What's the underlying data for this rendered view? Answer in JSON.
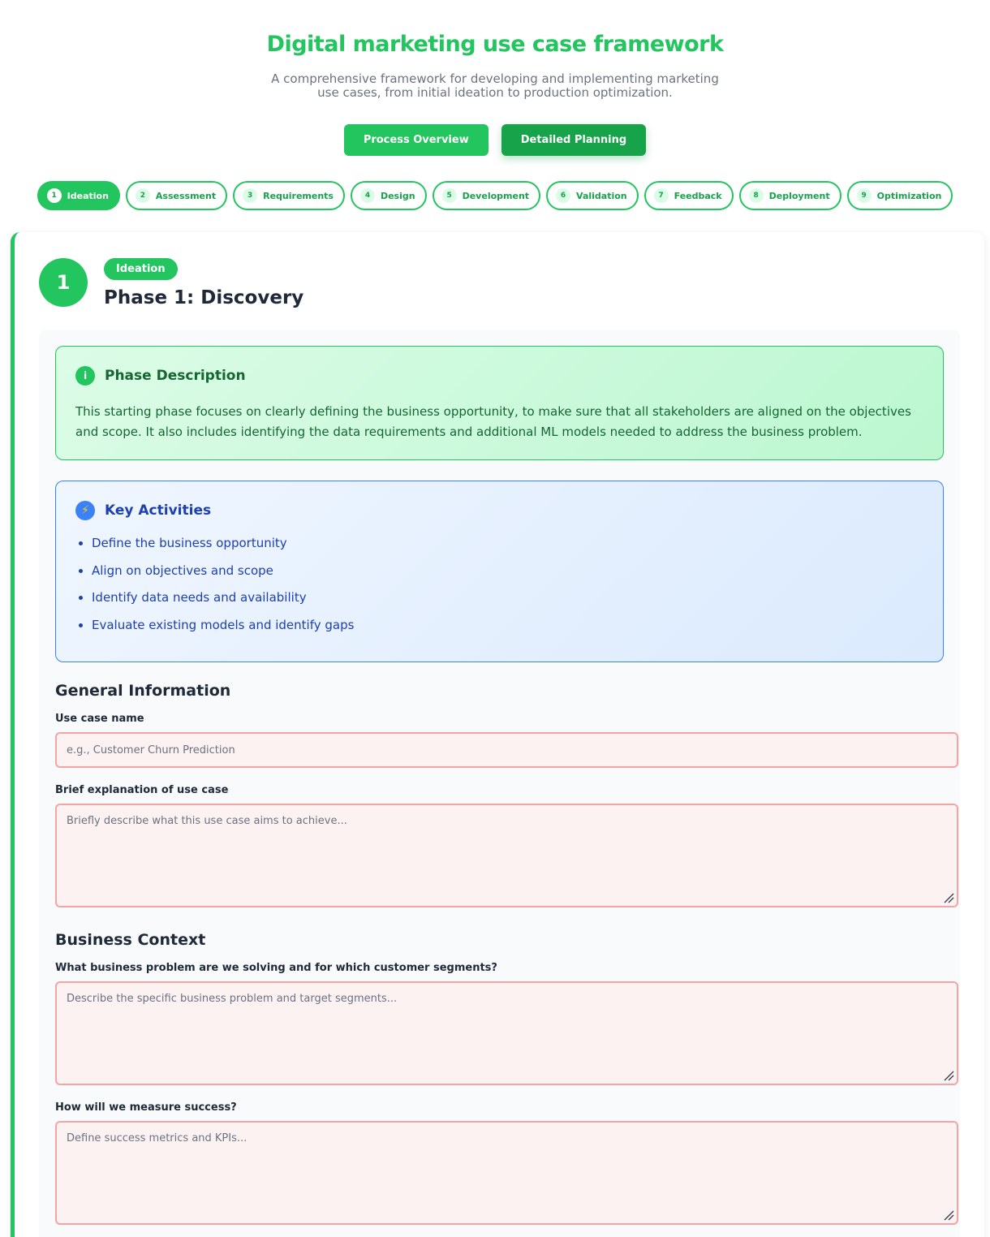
{
  "header": {
    "title": "Digital marketing use case framework",
    "subtitle": "A comprehensive framework for developing and implementing marketing use cases, from initial ideation to production optimization."
  },
  "view_buttons": {
    "process_overview": "Process Overview",
    "detailed_planning": "Detailed Planning",
    "active": "detailed_planning"
  },
  "phase_tabs": [
    {
      "num": "1",
      "label": "Ideation",
      "active": true
    },
    {
      "num": "2",
      "label": "Assessment"
    },
    {
      "num": "3",
      "label": "Requirements"
    },
    {
      "num": "4",
      "label": "Design"
    },
    {
      "num": "5",
      "label": "Development"
    },
    {
      "num": "6",
      "label": "Validation"
    },
    {
      "num": "7",
      "label": "Feedback"
    },
    {
      "num": "8",
      "label": "Deployment"
    },
    {
      "num": "9",
      "label": "Optimization"
    }
  ],
  "phase": {
    "number": "1",
    "badge": "Ideation",
    "title": "Phase 1: Discovery",
    "description": {
      "icon": "info-icon",
      "title": "Phase Description",
      "text": "This starting phase focuses on clearly defining the business opportunity, to make sure that all stakeholders are aligned on the objectives and scope. It also includes identifying the data requirements and additional ML models needed to address the business problem."
    },
    "activities": {
      "icon": "lightning-icon",
      "title": "Key Activities",
      "items": [
        "Define the business opportunity",
        "Align on objectives and scope",
        "Identify data needs and availability",
        "Evaluate existing models and identify gaps"
      ]
    }
  },
  "general": {
    "title": "General Information",
    "use_case_name_label": "Use case name",
    "use_case_name_placeholder": "e.g., Customer Churn Prediction",
    "explanation_label": "Brief explanation of use case",
    "explanation_placeholder": "Briefly describe what this use case aims to achieve..."
  },
  "business": {
    "title": "Business Context",
    "problem_label": "What business problem are we solving and for which customer segments?",
    "problem_placeholder": "Describe the specific business problem and target segments...",
    "success_label": "How will we measure success?",
    "success_placeholder": "Define success metrics and KPIs..."
  },
  "colors": {
    "primary": "#22c55e",
    "primary_dark": "#16a34a",
    "info_blue": "#3b82f6",
    "field_border": "#f5a3a3",
    "field_bg": "#fdf2f2"
  }
}
